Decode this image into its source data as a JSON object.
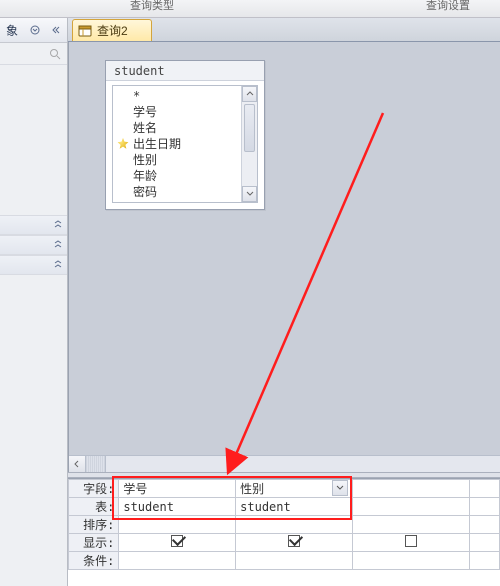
{
  "ribbon": {
    "group_left": "查询类型",
    "group_right": "查询设置"
  },
  "nav": {
    "objects_label": "象"
  },
  "tab": {
    "title": "查询2"
  },
  "table_window": {
    "title": "student",
    "fields": [
      "*",
      "学号",
      "姓名",
      "出生日期",
      "性别",
      "年龄",
      "密码"
    ],
    "key_field_index": 3
  },
  "qbe": {
    "rows": {
      "field": "字段:",
      "table": "表:",
      "sort": "排序:",
      "show": "显示:",
      "criteria": "条件:"
    },
    "columns": [
      {
        "field": "学号",
        "table": "student",
        "show": true,
        "selected": false
      },
      {
        "field": "性别",
        "table": "student",
        "show": true,
        "selected": true
      },
      {
        "field": "",
        "table": "",
        "show": false,
        "selected": false
      }
    ]
  }
}
